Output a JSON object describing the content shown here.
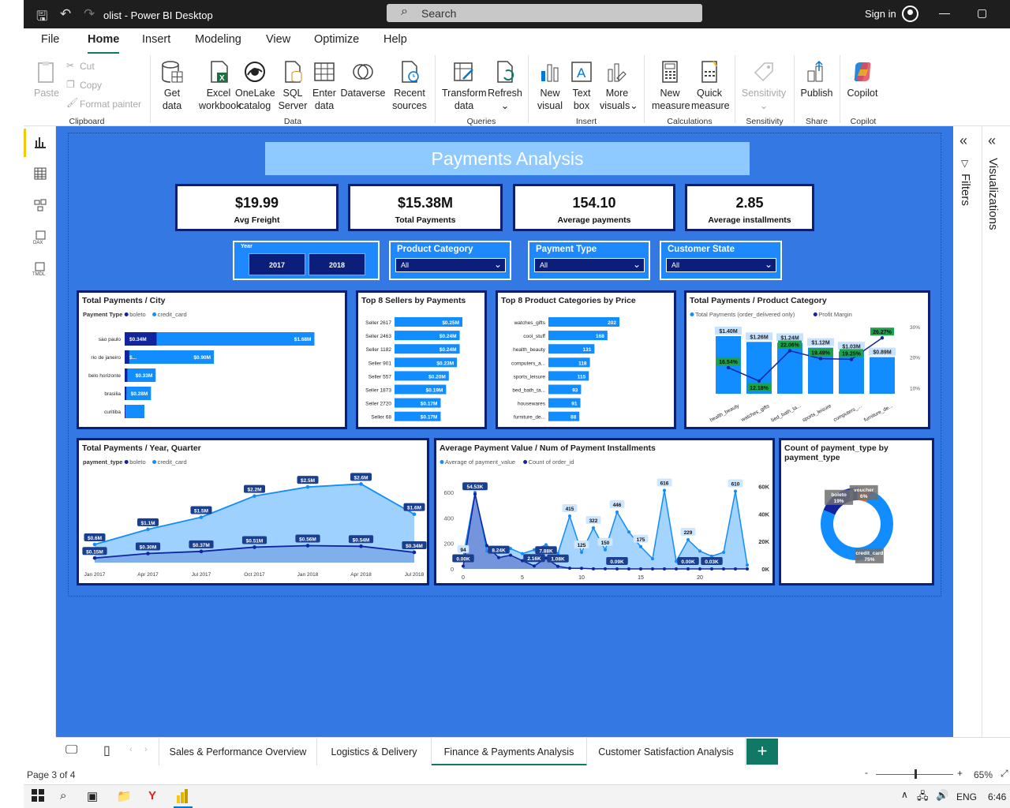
{
  "window": {
    "title": "olist - Power BI Desktop",
    "search_placeholder": "Search",
    "sign_in": "Sign in"
  },
  "menu": [
    "File",
    "Home",
    "Insert",
    "Modeling",
    "View",
    "Optimize",
    "Help"
  ],
  "ribbon": {
    "clipboard": {
      "paste": "Paste",
      "cut": "Cut",
      "copy": "Copy",
      "format_painter": "Format painter",
      "group": "Clipboard"
    },
    "data": {
      "get": [
        "Get",
        "data"
      ],
      "excel": [
        "Excel",
        "workbook"
      ],
      "onelake": [
        "OneLake",
        "catalog"
      ],
      "sql": [
        "SQL",
        "Server"
      ],
      "enter": [
        "Enter",
        "data"
      ],
      "dataverse": "Dataverse",
      "recent": [
        "Recent",
        "sources"
      ],
      "group": "Data"
    },
    "queries": {
      "transform": [
        "Transform",
        "data"
      ],
      "refresh": "Refresh",
      "group": "Queries"
    },
    "insert": {
      "new_visual": [
        "New",
        "visual"
      ],
      "text_box": [
        "Text",
        "box"
      ],
      "more_visuals": [
        "More",
        "visuals"
      ],
      "group": "Insert"
    },
    "calculations": {
      "new_measure": [
        "New",
        "measure"
      ],
      "quick_measure": [
        "Quick",
        "measure"
      ],
      "group": "Calculations"
    },
    "sensitivity": {
      "label": "Sensitivity",
      "group": "Sensitivity"
    },
    "share": {
      "publish": "Publish",
      "group": "Share"
    },
    "copilot": {
      "label": "Copilot",
      "group": "Copilot"
    }
  },
  "panes": {
    "filters": "Filters",
    "visualizations": "Visualizations"
  },
  "report": {
    "title": "Payments Analysis",
    "kpis": [
      {
        "value": "$19.99",
        "label": "Avg Freight"
      },
      {
        "value": "$15.38M",
        "label": "Total Payments"
      },
      {
        "value": "154.10",
        "label": "Average payments"
      },
      {
        "value": "2.85",
        "label": "Average installments"
      }
    ],
    "slicers": {
      "year": {
        "title": "Year",
        "options": [
          "2017",
          "2018"
        ]
      },
      "product_category": {
        "title": "Product Category",
        "value": "All"
      },
      "payment_type": {
        "title": "Payment Type",
        "value": "All"
      },
      "customer_state": {
        "title": "Customer State",
        "value": "All"
      }
    },
    "colors": {
      "boleto": "#12239e",
      "credit_card": "#118dff",
      "canvas": "#3478e3"
    }
  },
  "chart_data": [
    {
      "id": "city",
      "type": "bar",
      "title": "Total Payments / City",
      "legend_title": "Payment Type",
      "legend": [
        "boleto",
        "credit_card"
      ],
      "categories": [
        "sao paulo",
        "rio de janeiro",
        "belo horizonte",
        "brasilia",
        "curitiba"
      ],
      "series": [
        {
          "name": "boleto",
          "values": [
            0.34,
            0.05,
            0.03,
            0.02,
            0.01
          ],
          "labels": [
            "$0.34M",
            "$...",
            "",
            "",
            ""
          ]
        },
        {
          "name": "credit_card",
          "values": [
            1.68,
            0.9,
            0.3,
            0.26,
            0.2
          ],
          "labels": [
            "$1.68M",
            "$0.90M",
            "$0.33M",
            "$0.28M",
            ""
          ]
        }
      ]
    },
    {
      "id": "sellers",
      "type": "bar",
      "title": "Top 8 Sellers by Payments",
      "categories": [
        "Seller 2617",
        "Seller 2463",
        "Seller 1182",
        "Seller 901",
        "Seller 557",
        "Seller 1873",
        "Seller 2720",
        "Seller 68"
      ],
      "values": [
        0.25,
        0.24,
        0.24,
        0.23,
        0.2,
        0.19,
        0.17,
        0.17
      ],
      "labels": [
        "$0.25M",
        "$0.24M",
        "$0.24M",
        "$0.23M",
        "$0.20M",
        "$0.19M",
        "$0.17M",
        "$0.17M"
      ]
    },
    {
      "id": "categories",
      "type": "bar",
      "title": "Top 8 Product Categories by Price",
      "categories": [
        "watches_gifts",
        "cool_stuff",
        "health_beauty",
        "computers_a...",
        "sports_leisure",
        "bed_bath_ta...",
        "housewares",
        "furniture_de..."
      ],
      "values": [
        202,
        168,
        131,
        118,
        115,
        93,
        91,
        88
      ],
      "labels": [
        "202",
        "168",
        "131",
        "118",
        "115",
        "93",
        "91",
        "88"
      ]
    },
    {
      "id": "product_combo",
      "type": "bar",
      "title": "Total Payments / Product Category",
      "legend": [
        "Total Payments (order_delivered only)",
        "Profit Margin"
      ],
      "categories": [
        "health_beauty",
        "watches_gifts",
        "bed_bath_ta...",
        "sports_leisure",
        "computers_...",
        "furniture_de..."
      ],
      "series": [
        {
          "name": "Total Payments (order_delivered only)",
          "values": [
            1.4,
            1.26,
            1.24,
            1.12,
            1.03,
            0.89
          ],
          "labels": [
            "$1.40M",
            "$1.26M",
            "$1.24M",
            "$1.12M",
            "$1.03M",
            "$0.89M"
          ]
        },
        {
          "name": "Profit Margin",
          "values": [
            16.54,
            12.18,
            22.06,
            19.49,
            19.25,
            26.27
          ],
          "labels": [
            "16.54%",
            "12.18%",
            "22.06%",
            "19.49%",
            "19.25%",
            "26.27%"
          ]
        }
      ],
      "y2_ticks": [
        "30%",
        "20%",
        "10%"
      ],
      "y2lim": [
        8,
        32
      ]
    },
    {
      "id": "year_quarter",
      "type": "area",
      "title": "Total Payments / Year, Quarter",
      "legend_title": "payment_type",
      "legend": [
        "boleto",
        "credit_card"
      ],
      "x": [
        "Jan 2017",
        "Apr 2017",
        "Jul 2017",
        "Oct 2017",
        "Jan 2018",
        "Apr 2018",
        "Jul 2018"
      ],
      "series": [
        {
          "name": "credit_card",
          "values": [
            0.6,
            1.1,
            1.5,
            2.2,
            2.5,
            2.6,
            1.6
          ],
          "labels": [
            "$0.6M",
            "$1.1M",
            "$1.5M",
            "$2.2M",
            "$2.5M",
            "$2.6M",
            "$1.6M"
          ]
        },
        {
          "name": "boleto",
          "values": [
            0.15,
            0.3,
            0.37,
            0.51,
            0.56,
            0.54,
            0.34
          ],
          "labels": [
            "$0.15M",
            "$0.30M",
            "$0.37M",
            "$0.51M",
            "$0.56M",
            "$0.54M",
            "$0.34M"
          ]
        }
      ],
      "ylim": [
        0,
        3
      ]
    },
    {
      "id": "installments",
      "type": "area",
      "title": "Average Payment Value / Num of Payment Installments",
      "legend": [
        "Average of payment_value",
        "Count of order_id"
      ],
      "x": [
        0,
        1,
        2,
        3,
        4,
        5,
        6,
        7,
        8,
        9,
        10,
        11,
        12,
        13,
        14,
        15,
        16,
        17,
        18,
        19,
        20,
        21,
        22,
        23,
        24
      ],
      "series": [
        {
          "name": "Average of payment_value",
          "values": [
            94,
            600,
            140,
            130,
            160,
            120,
            150,
            190,
            120,
            415,
            130,
            322,
            150,
            446,
            290,
            175,
            80,
            616,
            60,
            229,
            140,
            100,
            130,
            610,
            30
          ]
        },
        {
          "name": "Count of order_id",
          "values": [
            2000,
            54530,
            17000,
            8240,
            10000,
            6000,
            2160,
            7880,
            1880,
            500,
            400,
            90,
            50,
            30,
            20,
            10,
            10,
            5,
            5,
            0,
            0,
            0,
            0,
            0,
            0
          ]
        }
      ],
      "point_labels": [
        {
          "s": 0,
          "i": 0,
          "text": "94"
        },
        {
          "s": 1,
          "i": 1,
          "text": "54.53K"
        },
        {
          "s": 1,
          "i": 0,
          "text": "0.00K"
        },
        {
          "s": 1,
          "i": 3,
          "text": "8.24K"
        },
        {
          "s": 1,
          "i": 6,
          "text": "2.16K"
        },
        {
          "s": 1,
          "i": 7,
          "text": "7.88K"
        },
        {
          "s": 1,
          "i": 8,
          "text": "1.08K"
        },
        {
          "s": 0,
          "i": 9,
          "text": "415"
        },
        {
          "s": 0,
          "i": 10,
          "text": "125"
        },
        {
          "s": 0,
          "i": 11,
          "text": "322"
        },
        {
          "s": 0,
          "i": 12,
          "text": "150"
        },
        {
          "s": 1,
          "i": 13,
          "text": "0.09K"
        },
        {
          "s": 0,
          "i": 13,
          "text": "446"
        },
        {
          "s": 0,
          "i": 15,
          "text": "175"
        },
        {
          "s": 0,
          "i": 17,
          "text": "616"
        },
        {
          "s": 0,
          "i": 19,
          "text": "229"
        },
        {
          "s": 1,
          "i": 19,
          "text": "0.00K"
        },
        {
          "s": 1,
          "i": 21,
          "text": "0.03K"
        },
        {
          "s": 0,
          "i": 23,
          "text": "610"
        }
      ],
      "y_ticks": [
        "600",
        "400",
        "200",
        "0"
      ],
      "y2_ticks": [
        "60K",
        "40K",
        "20K",
        "0K"
      ],
      "x_ticks": [
        "0",
        "5",
        "10",
        "15",
        "20"
      ],
      "ylim": [
        0,
        700
      ],
      "y2lim": [
        0,
        65000
      ]
    },
    {
      "id": "payment_type",
      "type": "pie",
      "title": "Count of payment_type by payment_type",
      "slices": [
        {
          "name": "credit_card",
          "value": 75,
          "label": "credit_card 75%"
        },
        {
          "name": "boleto",
          "value": 19,
          "label": "boleto 19%"
        },
        {
          "name": "voucher",
          "value": 6,
          "label": "voucher 6%"
        }
      ]
    }
  ],
  "tabs": [
    "Sales & Performance Overview",
    "Logistics & Delivery",
    "Finance & Payments Analysis",
    "Customer Satisfaction Analysis"
  ],
  "status": {
    "page": "Page 3 of 4",
    "zoom": "65%"
  },
  "taskbar": {
    "lang": "ENG",
    "time": "6:46"
  }
}
